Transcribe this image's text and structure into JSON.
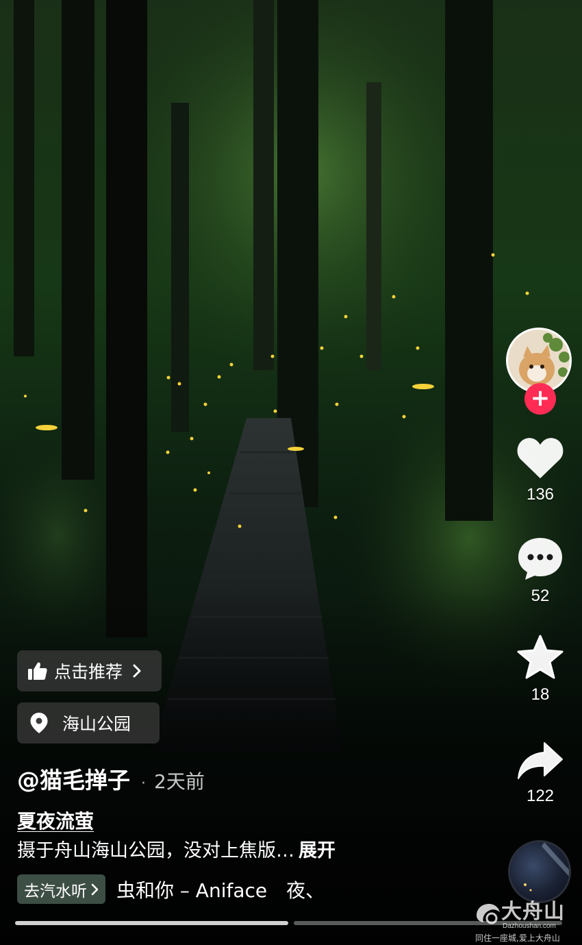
{
  "feed": {
    "recommend_label": "点击推荐",
    "location_label": "海山公园",
    "author": "@猫毛掸子",
    "separator": "·",
    "posted_time": "2天前",
    "title": "夏夜流萤",
    "description": "摄于舟山海山公园，没对上焦版…",
    "expand_label": "展开",
    "music_link_label": "去汽水听",
    "music_track": "虫和你 – Aniface　夜、"
  },
  "actions": {
    "likes": "136",
    "comments": "52",
    "favorites": "18",
    "shares": "122"
  },
  "follow_symbol": "+",
  "progress": {
    "current_segment_fraction": 1.0,
    "segments": 2
  },
  "watermark": {
    "logo_text": "大舟山",
    "domain": "Dazhoushan.com",
    "slogan": "同住一座城,爱上大舟山"
  },
  "colors": {
    "follow_button": "#fe2c55",
    "music_chip": "#3d4e45",
    "chip_background": "rgba(60,60,60,0.72)"
  }
}
